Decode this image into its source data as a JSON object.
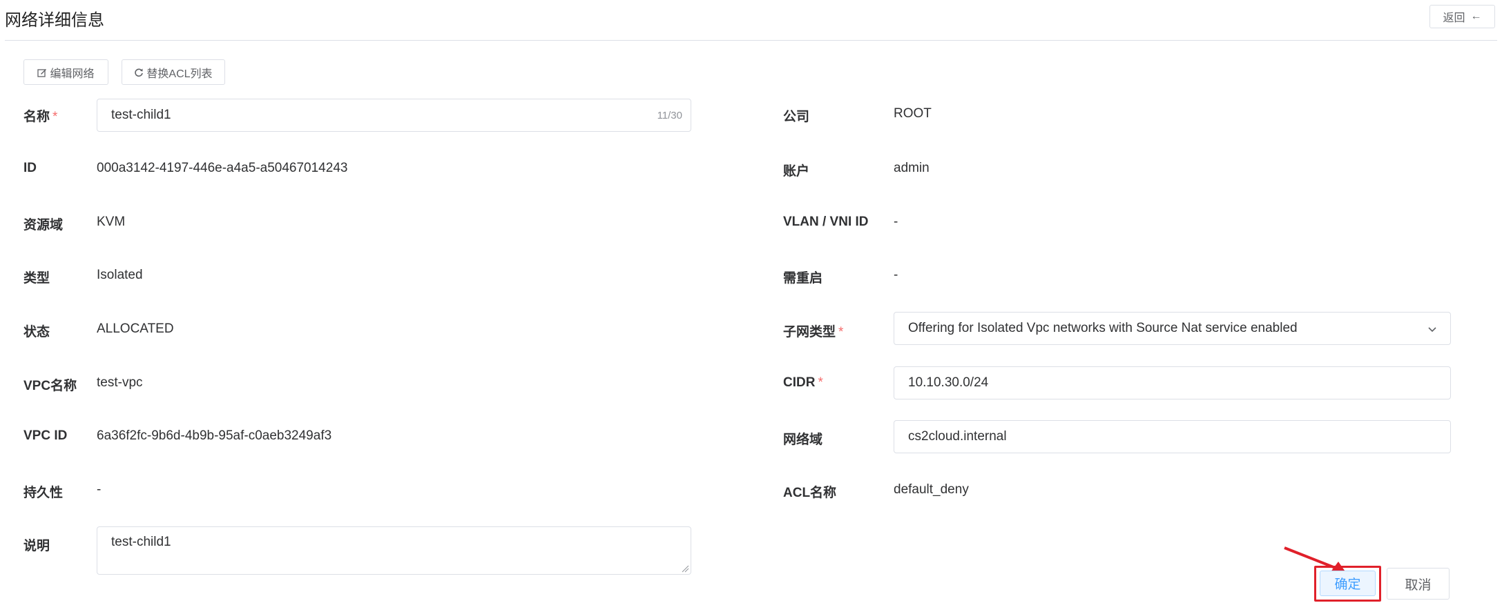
{
  "header": {
    "title": "网络详细信息",
    "back_label": "返回"
  },
  "toolbar": {
    "edit_label": "编辑网络",
    "replace_acl_label": "替换ACL列表"
  },
  "left": {
    "name_label": "名称",
    "name_value": "test-child1",
    "name_counter": "11/30",
    "id_label": "ID",
    "id_value": "000a3142-4197-446e-a4a5-a50467014243",
    "zone_label": "资源域",
    "zone_value": "KVM",
    "type_label": "类型",
    "type_value": "Isolated",
    "state_label": "状态",
    "state_value": "ALLOCATED",
    "vpc_name_label": "VPC名称",
    "vpc_name_value": "test-vpc",
    "vpc_id_label": "VPC ID",
    "vpc_id_value": "6a36f2fc-9b6d-4b9b-95af-c0aeb3249af3",
    "persistence_label": "持久性",
    "persistence_value": "-",
    "desc_label": "说明",
    "desc_value": "test-child1"
  },
  "right": {
    "company_label": "公司",
    "company_value": "ROOT",
    "account_label": "账户",
    "account_value": "admin",
    "vlan_label": "VLAN / VNI ID",
    "vlan_value": "-",
    "restart_label": "需重启",
    "restart_value": "-",
    "subnet_type_label": "子网类型",
    "subnet_type_value": "Offering for Isolated Vpc networks with Source Nat service enabled",
    "cidr_label": "CIDR",
    "cidr_value": "10.10.30.0/24",
    "domain_label": "网络域",
    "domain_value": "cs2cloud.internal",
    "acl_label": "ACL名称",
    "acl_value": "default_deny"
  },
  "required_mark": "*",
  "actions": {
    "confirm_label": "确定",
    "cancel_label": "取消"
  },
  "colors": {
    "primary": "#409eff",
    "required": "#f56c6c",
    "highlight": "#e0202a",
    "border": "#dcdfe6"
  }
}
